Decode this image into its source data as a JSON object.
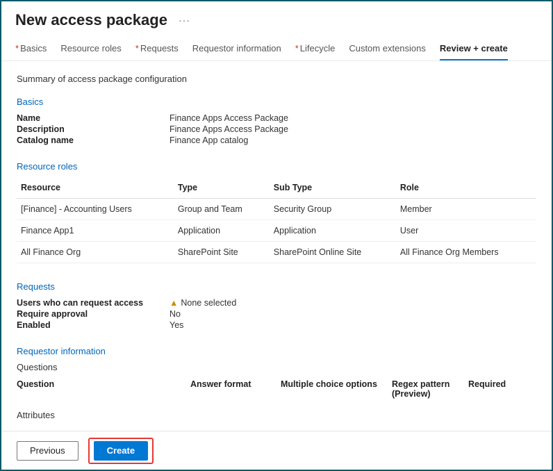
{
  "header": {
    "title": "New access package",
    "ellipsis": "···"
  },
  "tabs": [
    {
      "label": "Basics",
      "required": true,
      "active": false
    },
    {
      "label": "Resource roles",
      "required": false,
      "active": false
    },
    {
      "label": "Requests",
      "required": true,
      "active": false
    },
    {
      "label": "Requestor information",
      "required": false,
      "active": false
    },
    {
      "label": "Lifecycle",
      "required": true,
      "active": false
    },
    {
      "label": "Custom extensions",
      "required": false,
      "active": false
    },
    {
      "label": "Review + create",
      "required": false,
      "active": true
    }
  ],
  "summary_heading": "Summary of access package configuration",
  "basics": {
    "title": "Basics",
    "rows": [
      {
        "label": "Name",
        "value": "Finance Apps Access Package"
      },
      {
        "label": "Description",
        "value": "Finance Apps Access Package"
      },
      {
        "label": "Catalog name",
        "value": "Finance App catalog"
      }
    ]
  },
  "resource_roles": {
    "title": "Resource roles",
    "columns": [
      "Resource",
      "Type",
      "Sub Type",
      "Role"
    ],
    "rows": [
      {
        "resource": "[Finance] - Accounting Users",
        "type": "Group and Team",
        "subType": "Security Group",
        "role": "Member"
      },
      {
        "resource": "Finance App1",
        "type": "Application",
        "subType": "Application",
        "role": "User"
      },
      {
        "resource": "All Finance Org",
        "type": "SharePoint Site",
        "subType": "SharePoint Online Site",
        "role": "All Finance Org Members"
      }
    ]
  },
  "requests": {
    "title": "Requests",
    "rows": [
      {
        "label": "Users who can request access",
        "value": "None selected",
        "warn": true
      },
      {
        "label": "Require approval",
        "value": "No",
        "warn": false
      },
      {
        "label": "Enabled",
        "value": "Yes",
        "warn": false
      }
    ]
  },
  "requestor_info": {
    "title": "Requestor information",
    "questions_heading": "Questions",
    "question_columns": [
      "Question",
      "Answer format",
      "Multiple choice options",
      "Regex pattern (Preview)",
      "Required"
    ],
    "attributes_heading": "Attributes"
  },
  "footer": {
    "previous": "Previous",
    "create": "Create"
  }
}
